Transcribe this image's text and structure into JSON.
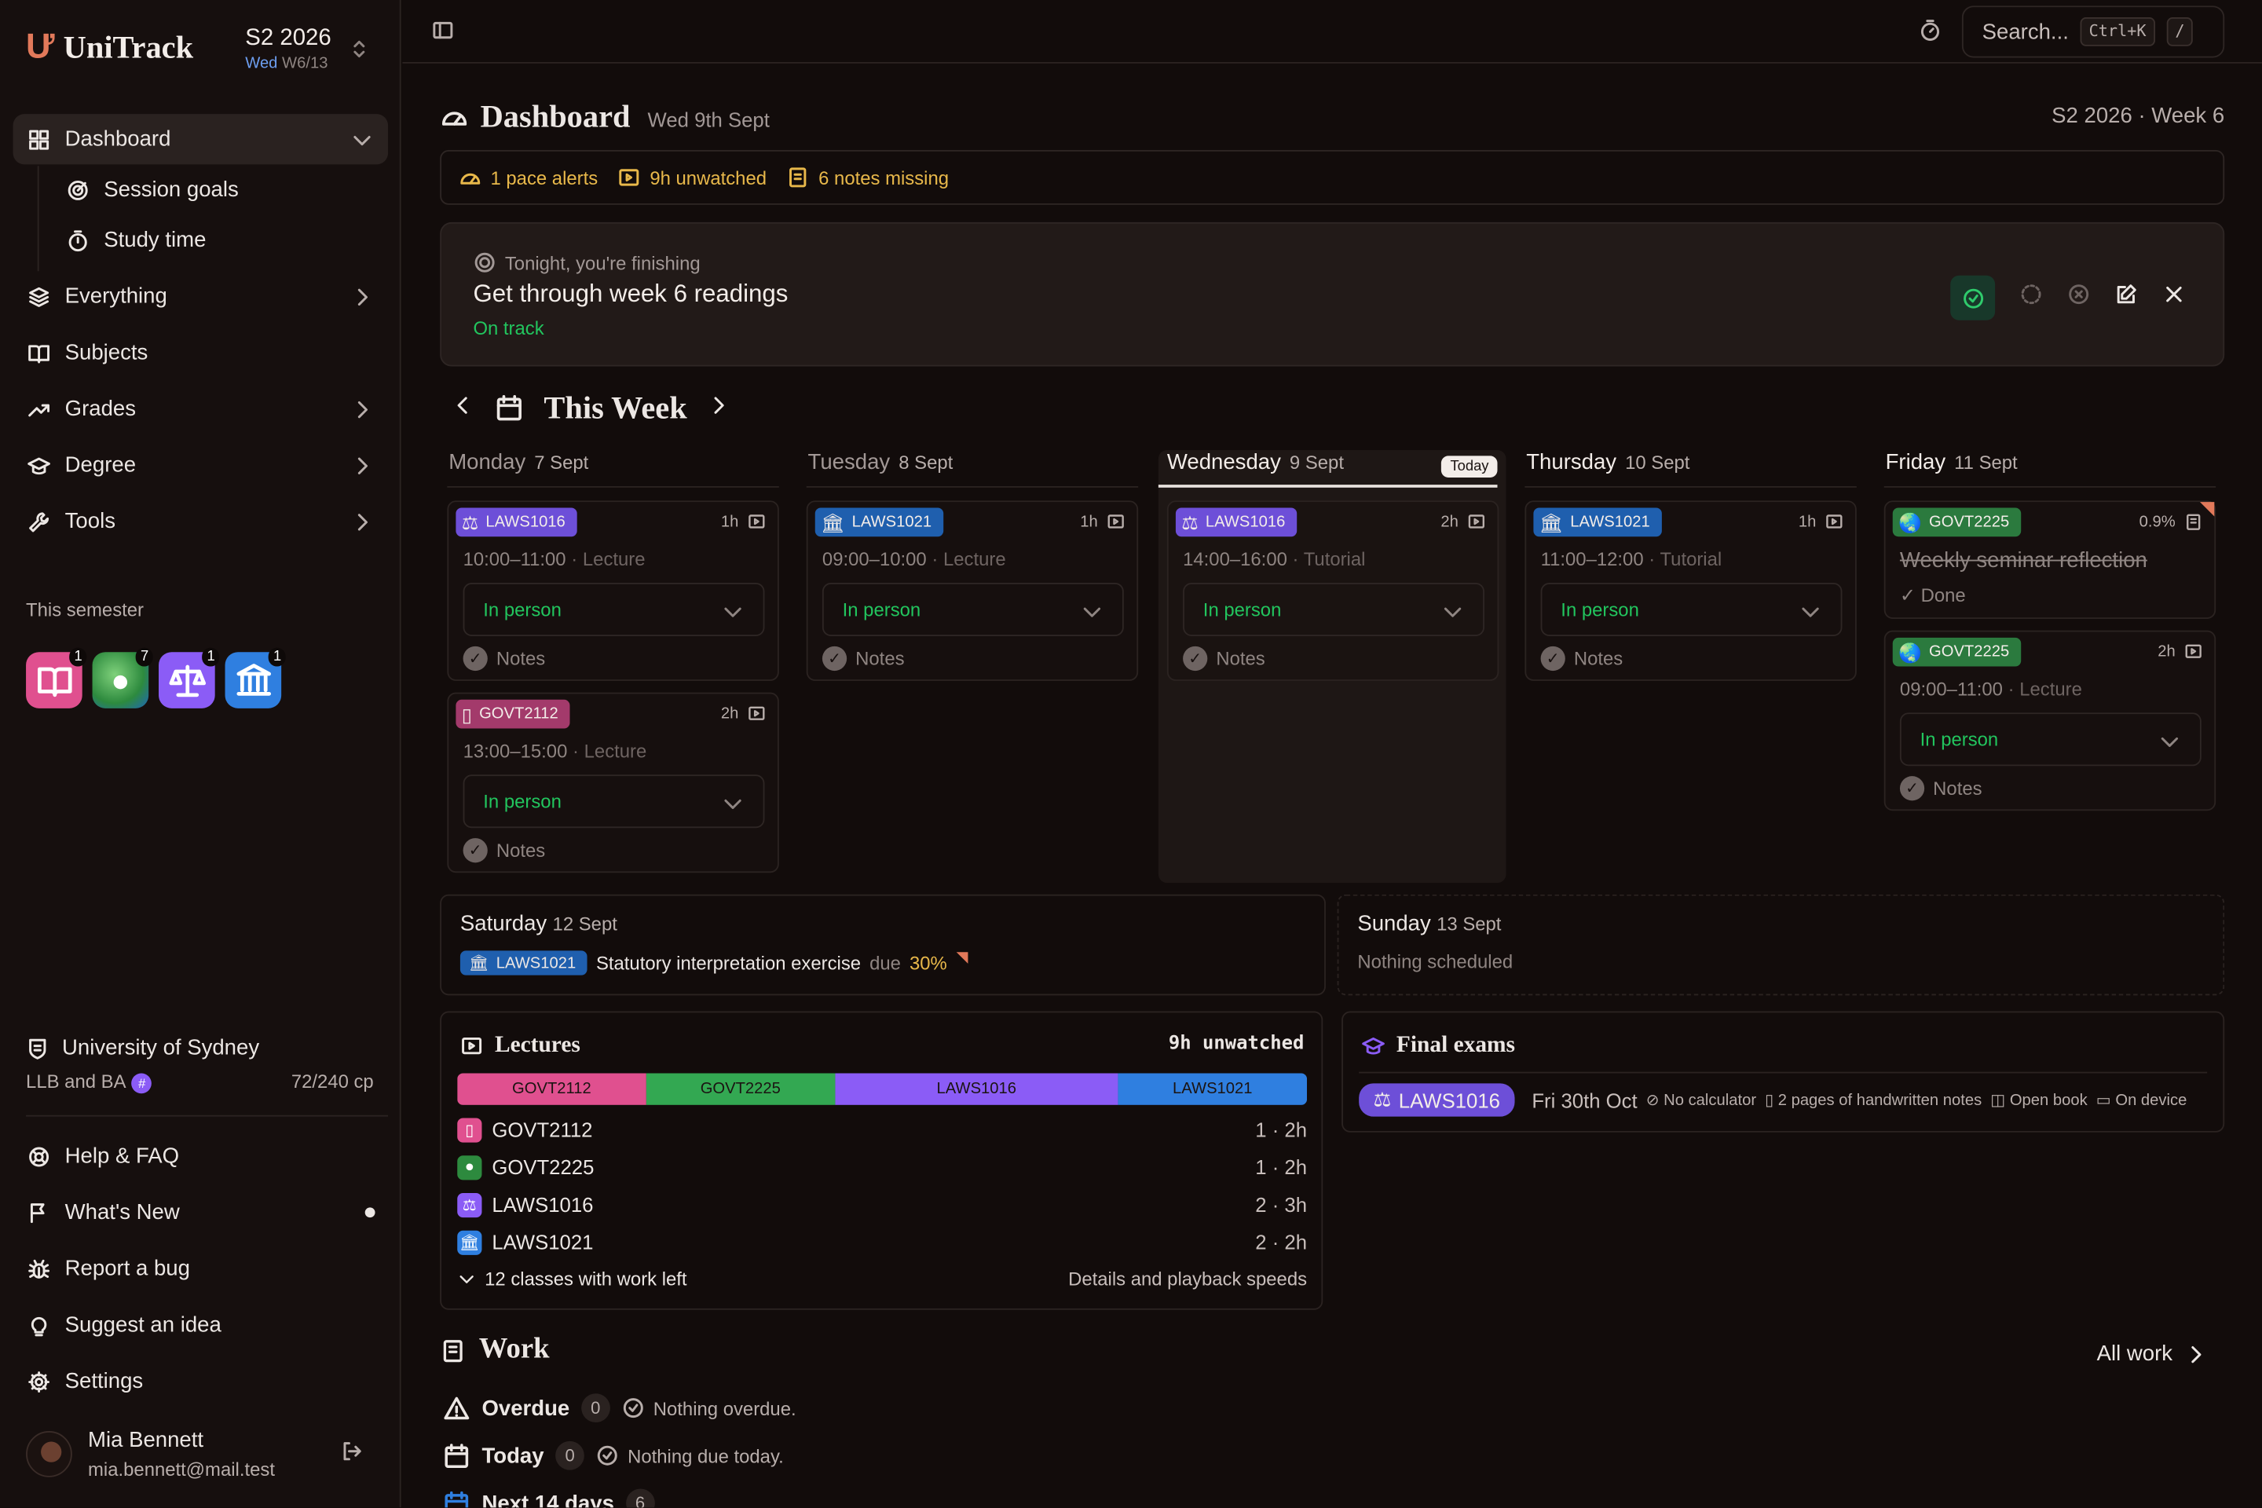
{
  "app": {
    "name": "UniTrack",
    "semester": "S2 2026",
    "week_prefix": "Wed",
    "week": "W6/13"
  },
  "sidebar": {
    "items": [
      {
        "label": "Dashboard"
      },
      {
        "label": "Session goals"
      },
      {
        "label": "Study time"
      },
      {
        "label": "Everything"
      },
      {
        "label": "Subjects"
      },
      {
        "label": "Grades"
      },
      {
        "label": "Degree"
      },
      {
        "label": "Tools"
      }
    ],
    "section_label": "This semester",
    "subject_badges": [
      {
        "icon": "book-icon",
        "count": "1",
        "color": "#e0508f"
      },
      {
        "icon": "globe-icon",
        "count": "7",
        "color": "#2d9a4a"
      },
      {
        "icon": "scales-icon",
        "count": "1",
        "color": "#8b5cf6"
      },
      {
        "icon": "columns-icon",
        "count": "1",
        "color": "#2f7fe0"
      }
    ],
    "university": "University of Sydney",
    "degree": "LLB and BA",
    "degree_tag": "#",
    "credits": "72/240 cp",
    "footer": [
      {
        "label": "Help & FAQ"
      },
      {
        "label": "What's New"
      },
      {
        "label": "Report a bug"
      },
      {
        "label": "Suggest an idea"
      },
      {
        "label": "Settings"
      }
    ],
    "user": {
      "name": "Mia Bennett",
      "email": "mia.bennett@mail.test"
    }
  },
  "topbar": {
    "search_label": "Search...",
    "shortcut": "Ctrl+K",
    "shortcut_alt": "/"
  },
  "dashboard": {
    "title": "Dashboard",
    "date": "Wed 9th Sept",
    "week_label": "S2 2026 · Week 6"
  },
  "alerts": [
    {
      "icon": "gauge-icon",
      "text": "1 pace alerts"
    },
    {
      "icon": "video-icon",
      "text": "9h unwatched"
    },
    {
      "icon": "notes-icon",
      "text": "6 notes missing"
    }
  ],
  "goal": {
    "kicker": "Tonight, you're finishing",
    "title": "Get through week 6 readings",
    "status": "On track"
  },
  "week": {
    "title": "This Week",
    "today_label": "Today",
    "days": [
      {
        "name": "Monday",
        "date": "7 Sept"
      },
      {
        "name": "Tuesday",
        "date": "8 Sept"
      },
      {
        "name": "Wednesday",
        "date": "9 Sept"
      },
      {
        "name": "Thursday",
        "date": "10 Sept"
      },
      {
        "name": "Friday",
        "date": "11 Sept"
      }
    ],
    "events": [
      {
        "code": "LAWS1016",
        "duration": "1h",
        "time": "10:00–11:00",
        "type": "Lecture",
        "mode": "In person",
        "notes": "Notes"
      },
      {
        "code": "GOVT2112",
        "duration": "2h",
        "time": "13:00–15:00",
        "type": "Lecture",
        "mode": "In person",
        "notes": "Notes"
      },
      {
        "code": "LAWS1021",
        "duration": "1h",
        "time": "09:00–10:00",
        "type": "Lecture",
        "mode": "In person",
        "notes": "Notes"
      },
      {
        "code": "LAWS1016",
        "duration": "2h",
        "time": "14:00–16:00",
        "type": "Tutorial",
        "mode": "In person",
        "notes": "Notes"
      },
      {
        "code": "LAWS1021",
        "duration": "1h",
        "time": "11:00–12:00",
        "type": "Tutorial",
        "mode": "In person",
        "notes": "Notes"
      },
      {
        "code": "GOVT2225",
        "duration": "0.9%",
        "title": "Weekly seminar reflection",
        "status": "Done"
      },
      {
        "code": "GOVT2225",
        "duration": "2h",
        "time": "09:00–11:00",
        "type": "Lecture",
        "mode": "In person",
        "notes": "Notes"
      }
    ],
    "saturday": {
      "name": "Saturday",
      "date": "12 Sept",
      "code": "LAWS1021",
      "task": "Statutory interpretation exercise",
      "due_label": "due",
      "weight": "30%"
    },
    "sunday": {
      "name": "Sunday",
      "date": "13 Sept",
      "empty": "Nothing scheduled"
    }
  },
  "lectures": {
    "title": "Lectures",
    "summary": "9h unwatched",
    "bar": [
      {
        "label": "GOVT2112",
        "share": 2,
        "color": "#e0508f"
      },
      {
        "label": "GOVT2225",
        "share": 2,
        "color": "#33a852"
      },
      {
        "label": "LAWS1016",
        "share": 3,
        "color": "#8b5cf6"
      },
      {
        "label": "LAWS1021",
        "share": 2,
        "color": "#2f7fe0"
      }
    ],
    "rows": [
      {
        "code": "GOVT2112",
        "value": "1 · 2h"
      },
      {
        "code": "GOVT2225",
        "value": "1 · 2h"
      },
      {
        "code": "LAWS1016",
        "value": "2 · 3h"
      },
      {
        "code": "LAWS1021",
        "value": "2 · 2h"
      }
    ],
    "footer_left": "12 classes with work left",
    "footer_right": "Details and playback speeds"
  },
  "exams": {
    "title": "Final exams",
    "code": "LAWS1016",
    "date": "Fri 30th Oct",
    "conditions": [
      "No calculator",
      "2 pages of handwritten notes",
      "Open book",
      "On device"
    ]
  },
  "work": {
    "title": "Work",
    "all_link": "All work",
    "rows": [
      {
        "label": "Overdue",
        "count": "0",
        "message": "Nothing overdue."
      },
      {
        "label": "Today",
        "count": "0",
        "message": "Nothing due today."
      },
      {
        "label": "Next 14 days",
        "count": "6",
        "message": ""
      }
    ]
  },
  "colors": {
    "accent": "#e2795a",
    "success": "#22c55e",
    "warning": "#e8b84a",
    "background": "#120c0b"
  }
}
